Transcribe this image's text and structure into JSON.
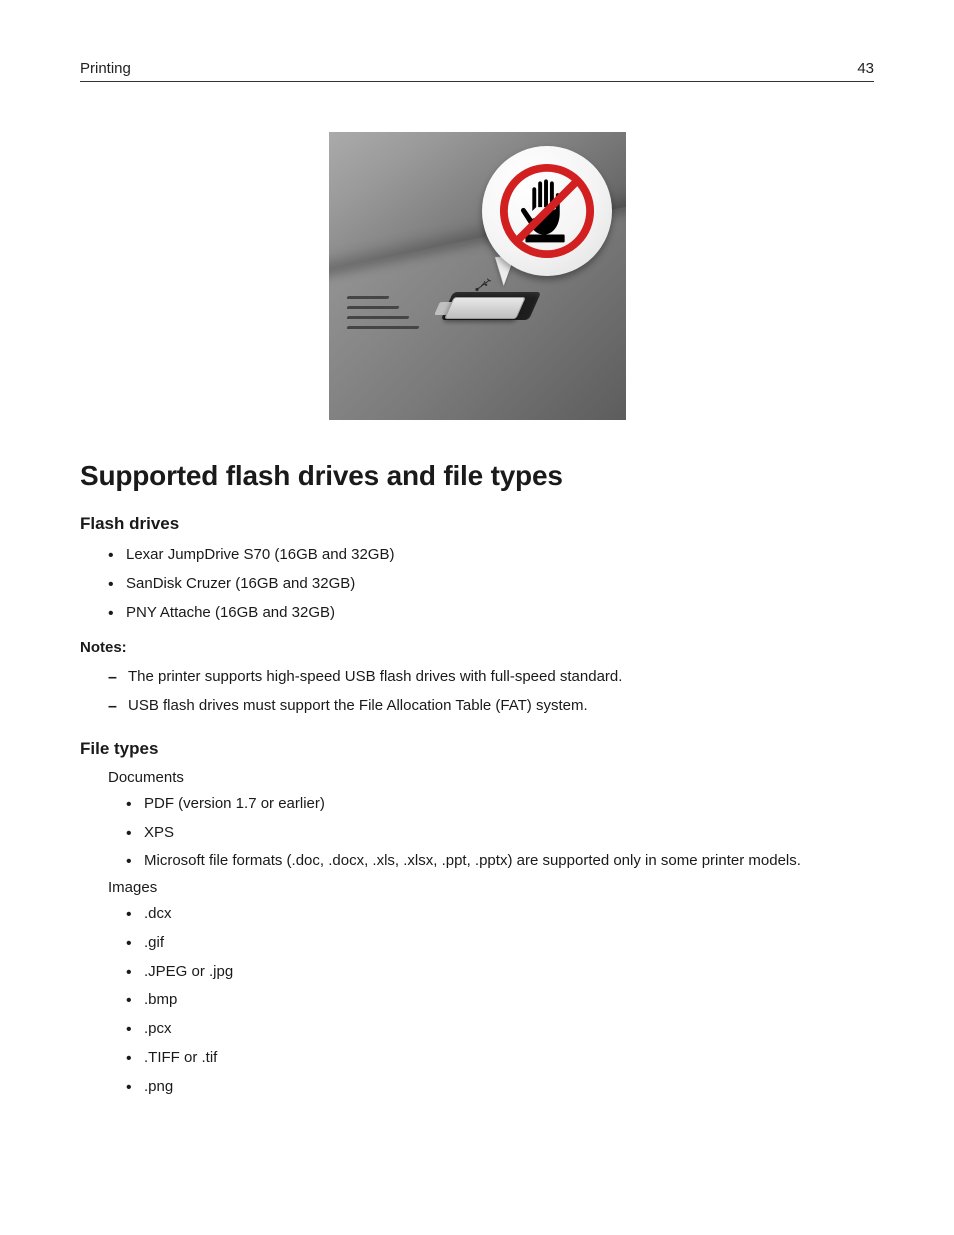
{
  "header": {
    "section": "Printing",
    "page": "43"
  },
  "title": "Supported flash drives and file types",
  "flash_drives": {
    "heading": "Flash drives",
    "items": [
      "Lexar JumpDrive S70 (16GB and 32GB)",
      "SanDisk Cruzer (16GB and 32GB)",
      "PNY Attache (16GB and 32GB)"
    ]
  },
  "notes": {
    "label": "Notes:",
    "items": [
      "The printer supports high-speed USB flash drives with full-speed standard.",
      "USB flash drives must support the File Allocation Table (FAT) system."
    ]
  },
  "file_types": {
    "heading": "File types",
    "documents_label": "Documents",
    "documents": [
      "PDF (version 1.7 or earlier)",
      "XPS",
      "Microsoft file formats (.doc, .docx, .xls, .xlsx, .ppt, .pptx) are supported only in some printer models."
    ],
    "images_label": "Images",
    "images": [
      ".dcx",
      ".gif",
      ".JPEG or .jpg",
      ".bmp",
      ".pcx",
      ".TIFF or .tif",
      ".png"
    ]
  }
}
